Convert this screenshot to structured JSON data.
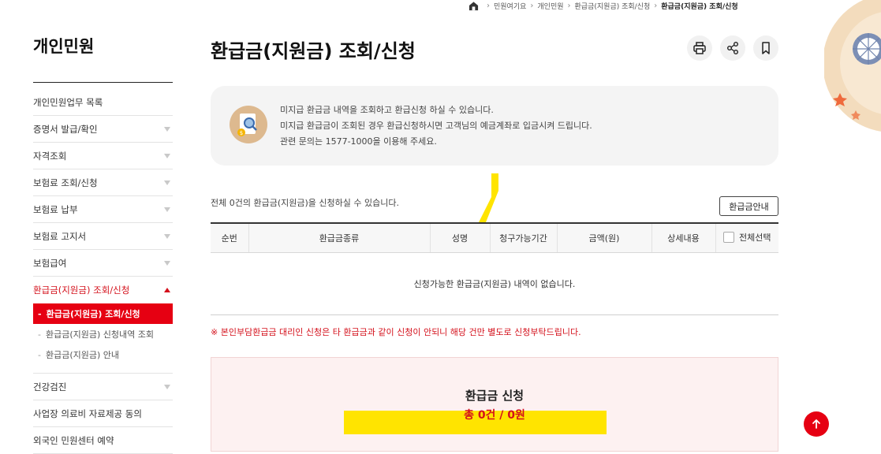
{
  "breadcrumb": [
    "민원여기요",
    "개인민원",
    "환급금(지원금) 조회/신청",
    "환급금(지원금) 조회/신청"
  ],
  "sidebar": {
    "title": "개인민원",
    "items": [
      {
        "label": "개인민원업무 목록"
      },
      {
        "label": "증명서 발급/확인"
      },
      {
        "label": "자격조회"
      },
      {
        "label": "보험료 조회/신청"
      },
      {
        "label": "보험료 납부"
      },
      {
        "label": "보험료 고지서"
      },
      {
        "label": "보험급여"
      },
      {
        "label": "환급금(지원금) 조회/신청"
      },
      {
        "label": "건강검진"
      },
      {
        "label": "사업장 의료비 자료제공 동의"
      },
      {
        "label": "외국인 민원센터 예약"
      }
    ],
    "sub_items": [
      {
        "label": "환급금(지원금) 조회/신청"
      },
      {
        "label": "환급금(지원금) 신청내역 조회"
      },
      {
        "label": "환급금(지원금) 안내"
      }
    ]
  },
  "page_title": "환급금(지원금) 조회/신청",
  "tools": [
    "print-icon",
    "share-icon",
    "bookmark-icon"
  ],
  "info": {
    "lines": [
      "미지급 환급금 내역을 조회하고 환급신청 하실 수 있습니다.",
      "미지급 환급금이 조회된 경우 환급신청하시면 고객님의 예금계좌로 입금시켜 드립니다.",
      "관련 문의는 1577-1000을 이용해 주세요."
    ]
  },
  "count_text": "전체 0건의 환급금(지원금)을 신청하실 수 있습니다.",
  "guide_button": "환급금안내",
  "table": {
    "headers": [
      "순번",
      "환급금종류",
      "성명",
      "청구가능기간",
      "금액(원)",
      "상세내용",
      "전체선택"
    ],
    "empty_message": "신청가능한 환급금(지원금) 내역이 없습니다."
  },
  "note": "※ 본인부담환급금 대리인 신청은 타 환급금과 같이 신청이 안되니 해당 건만 별도로 신청부탁드립니다.",
  "apply": {
    "title": "환급금 신청",
    "total": "총 0건 / 0원"
  },
  "colors": {
    "accent": "#e60012",
    "highlight": "#ffe400"
  }
}
